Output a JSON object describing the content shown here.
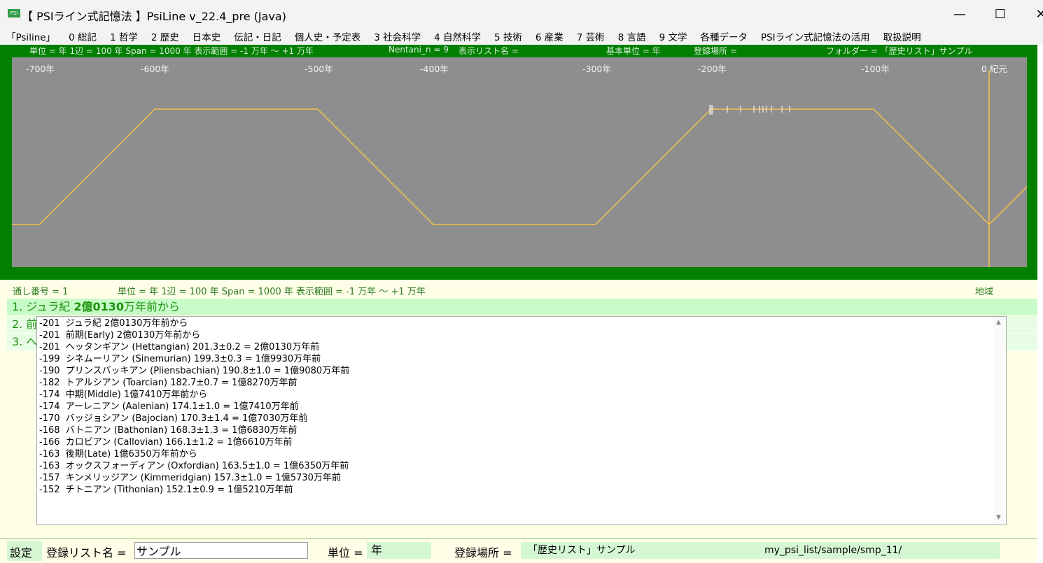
{
  "window": {
    "icon_text": "PSI",
    "title": "【 PSIライン式記憶法 】PsiLine v_22.4_pre (Java)",
    "minimize": "—",
    "maximize": "☐",
    "close": "✕"
  },
  "menu": [
    "「Psiline」",
    "0 総記",
    "1 哲学",
    "2 歴史",
    "日本史",
    "伝記・日記",
    "個人史・予定表",
    "3 社会科学",
    "4 自然科学",
    "5 技術",
    "6 産業",
    "7 芸術",
    "8 言語",
    "9 文学",
    "各種データ",
    "PSIライン式記憶法の活用",
    "取扱説明"
  ],
  "timeline": {
    "info": {
      "unit_span": "単位 = 年  1辺 = 100 年  Span = 1000 年  表示範囲 = -1 万年 〜 +1 万年",
      "nentani": "Nentani_n = 9",
      "list_name": "表示リスト名 =",
      "base_unit": "基本単位 = 年",
      "reg_place": "登録場所 =",
      "folder": "フォルダー = 「歴史リスト」サンプル"
    },
    "ticks": [
      "-700年",
      "-600年",
      "-500年",
      "-400年",
      "-300年",
      "-200年",
      "-100年",
      "0 紀元"
    ],
    "line_color": "#f2c24a",
    "background_color": "#8e8e8e",
    "frame_color": "#007f00"
  },
  "status": {
    "serial": "通し番号 = 1",
    "unit_span": "単位 = 年  1辺 = 100 年  Span = 1000 年  表示範囲 = -1 万年 〜 +1 万年",
    "region": "地域"
  },
  "entries": {
    "e1_prefix": "1. ジュラ紀 ",
    "e1_bold": "2億0130",
    "e1_suffix": "万年前から",
    "e2": "2. 前",
    "e3": "3. へ"
  },
  "popup_lines": [
    "-201  ジュラ紀 2億0130万年前から",
    "-201  前期(Early) 2億0130万年前から",
    "-201  ヘッタンギアン (Hettangian) 201.3±0.2 = 2億0130万年前",
    "-199  シネムーリアン (Sinemurian) 199.3±0.3 = 1億9930万年前",
    "-190  プリンスバッキアン (Pliensbachian) 190.8±1.0 = 1億9080万年前",
    "-182  トアルシアン (Toarcian) 182.7±0.7 = 1億8270万年前",
    "-174  中期(Middle) 1億7410万年前から",
    "-174  アーレニアン (Aalenian) 174.1±1.0 = 1億7410万年前",
    "-170  バッジョシアン (Bajocian) 170.3±1.4 = 1億7030万年前",
    "-168  バトニアン (Bathonian) 168.3±1.3 = 1億6830万年前",
    "-166  カロビアン (Callovian) 166.1±1.2 = 1億6610万年前",
    "-163  後期(Late) 1億6350万年前から",
    "-163  オックスフォーディアン (Oxfordian) 163.5±1.0 = 1億6350万年前",
    "-157  キンメリッジアン (Kimmeridgian) 157.3±1.0 = 1億5730万年前",
    "-152  チトニアン (Tithonian) 152.1±0.9 = 1億5210万年前"
  ],
  "bottom": {
    "settings": "設定",
    "reglist_label": "登録リスト名 =",
    "reglist_value": "サンプル",
    "unit_label": "単位 =",
    "unit_value": "年",
    "place_label": "登録場所 =",
    "place_name": "「歴史リスト」サンプル",
    "place_path": "my_psi_list/sample/smp_11/"
  }
}
